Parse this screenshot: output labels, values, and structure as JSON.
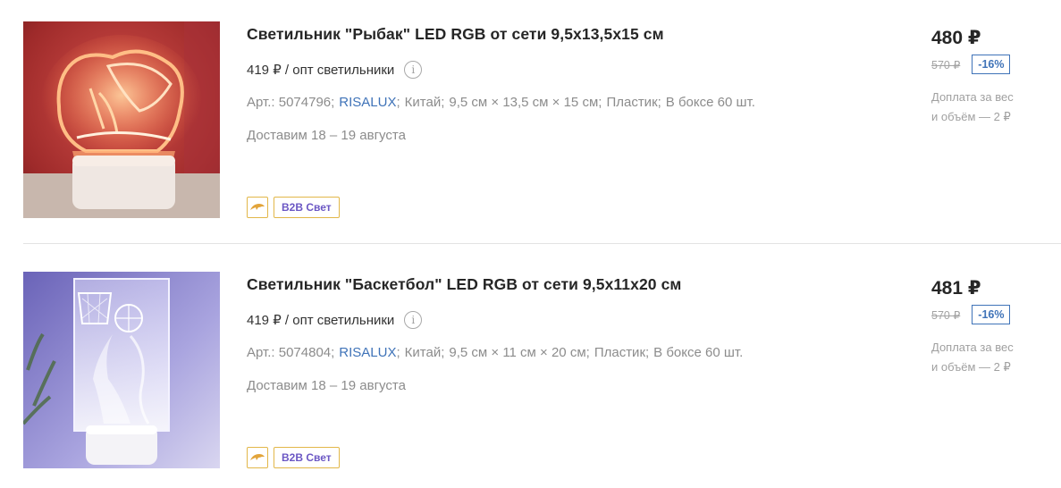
{
  "products": [
    {
      "title": "Светильник \"Рыбак\" LED RGB от сети 9,5х13,5х15 см",
      "opt_price": "419 ₽ / опт светильники",
      "art": "Арт.: 5074796",
      "brand": "RISALUX",
      "country": "Китай",
      "size": "9,5 см × 13,5 см × 15 см",
      "material": "Пластик",
      "box": "В боксе 60 шт.",
      "delivery": "Доставим 18 – 19 августа",
      "badge_label": "B2B Свет",
      "price": "480 ₽",
      "old_price": "570 ₽",
      "discount": "-16%",
      "extra_line1": "Доплата за вес",
      "extra_line2": "и объём — 2 ₽"
    },
    {
      "title": "Светильник \"Баскетбол\" LED RGB от сети 9,5х11х20 см",
      "opt_price": "419 ₽ / опт светильники",
      "art": "Арт.: 5074804",
      "brand": "RISALUX",
      "country": "Китай",
      "size": "9,5 см × 11 см × 20 см",
      "material": "Пластик",
      "box": "В боксе 60 шт.",
      "delivery": "Доставим 18 – 19 августа",
      "badge_label": "B2B Свет",
      "price": "481 ₽",
      "old_price": "570 ₽",
      "discount": "-16%",
      "extra_line1": "Доплата за вес",
      "extra_line2": "и объём — 2 ₽"
    }
  ],
  "icons": {
    "info": "info-icon",
    "dolphin": "dolphin-icon"
  },
  "colors": {
    "brand_link": "#3f73b8",
    "badge_border": "#e2b749",
    "badge_text": "#6b57c4"
  }
}
